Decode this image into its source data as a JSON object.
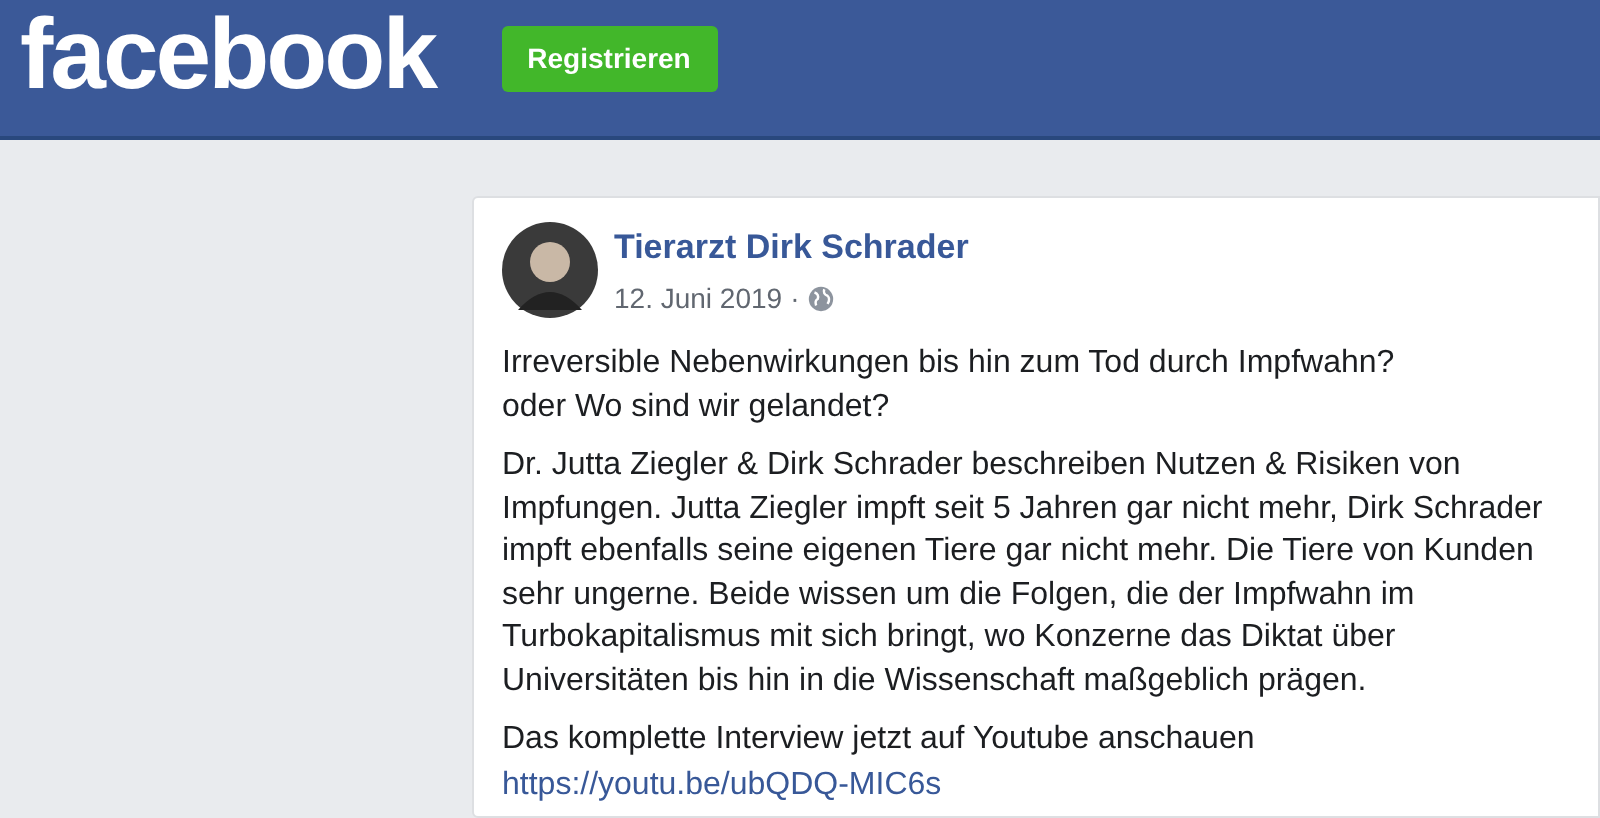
{
  "header": {
    "logo": "facebook",
    "register_button": "Registrieren"
  },
  "post": {
    "author": "Tierarzt Dirk Schrader",
    "date": "12. Juni 2019",
    "separator": "·",
    "paragraphs": [
      {
        "lines": [
          "Irreversible Nebenwirkungen bis hin zum Tod durch Impfwahn?",
          "oder Wo sind wir gelandet?"
        ]
      },
      {
        "lines": [
          "Dr. Jutta Ziegler & Dirk Schrader beschreiben Nutzen & Risiken von",
          "Impfungen. Jutta Ziegler impft seit 5 Jahren gar nicht mehr, Dirk Schrader",
          "impft ebenfalls seine eigenen Tiere gar nicht mehr. Die Tiere von Kunden",
          "sehr ungerne. Beide wissen um die Folgen, die der Impfwahn im",
          "Turbokapitalismus mit sich bringt, wo Konzerne das Diktat über",
          "Universitäten bis hin in die Wissenschaft maßgeblich prägen."
        ]
      },
      {
        "lines": [
          "Das komplette Interview jetzt auf Youtube anschauen"
        ]
      }
    ],
    "link": "https://youtu.be/ubQDQ-MIC6s"
  }
}
